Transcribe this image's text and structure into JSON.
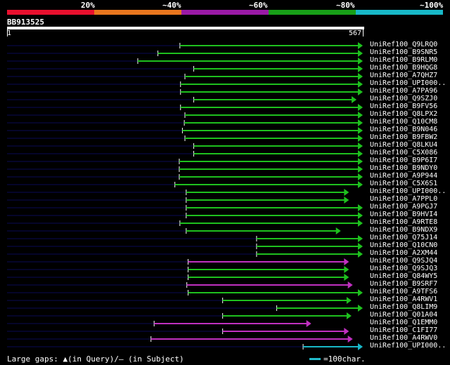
{
  "legend": {
    "segments": [
      {
        "color": "#e8102e",
        "label": "20%"
      },
      {
        "color": "#e8761e",
        "label": "~40%"
      },
      {
        "color": "#9a1aa6",
        "label": "~60%"
      },
      {
        "color": "#18a018",
        "label": "~80%"
      },
      {
        "color": "#18b8c8",
        "label": "~100%"
      }
    ]
  },
  "query": {
    "name": "BB913525",
    "start": "1",
    "end": "567",
    "length": 567
  },
  "colors": {
    "green": "#1ec01e",
    "magenta": "#c030c0",
    "cyan": "#18b8c8",
    "gap": "#0a0a55"
  },
  "hits": [
    {
      "label": "UniRef100_Q9LRQ0",
      "start": 276,
      "end": 567,
      "color": "green"
    },
    {
      "label": "UniRef100_B9SNR5",
      "start": 241,
      "end": 567,
      "color": "green"
    },
    {
      "label": "UniRef100_B9RLM0",
      "start": 209,
      "end": 567,
      "color": "green"
    },
    {
      "label": "UniRef100_B9HQG8",
      "start": 298,
      "end": 567,
      "color": "green"
    },
    {
      "label": "UniRef100_A7QHZ7",
      "start": 284,
      "end": 567,
      "color": "green"
    },
    {
      "label": "UniRef100_UPI000..",
      "start": 277,
      "end": 567,
      "color": "green"
    },
    {
      "label": "UniRef100_A7PA96",
      "start": 277,
      "end": 567,
      "color": "green"
    },
    {
      "label": "UniRef100_Q9SZJ0",
      "start": 298,
      "end": 557,
      "color": "green"
    },
    {
      "label": "UniRef100_B9FV56",
      "start": 277,
      "end": 567,
      "color": "green"
    },
    {
      "label": "UniRef100_Q8LPX2",
      "start": 284,
      "end": 567,
      "color": "green"
    },
    {
      "label": "UniRef100_Q10CM8",
      "start": 283,
      "end": 567,
      "color": "green"
    },
    {
      "label": "UniRef100_B9N046",
      "start": 280,
      "end": 567,
      "color": "green"
    },
    {
      "label": "UniRef100_B9FBW2",
      "start": 284,
      "end": 567,
      "color": "green"
    },
    {
      "label": "UniRef100_Q8LKU4",
      "start": 298,
      "end": 567,
      "color": "green"
    },
    {
      "label": "UniRef100_C5X086",
      "start": 298,
      "end": 567,
      "color": "green"
    },
    {
      "label": "UniRef100_B9P6I7",
      "start": 275,
      "end": 567,
      "color": "green"
    },
    {
      "label": "UniRef100_B9NDY0",
      "start": 275,
      "end": 567,
      "color": "green"
    },
    {
      "label": "UniRef100_A9P944",
      "start": 275,
      "end": 567,
      "color": "green"
    },
    {
      "label": "UniRef100_C5X6S1",
      "start": 268,
      "end": 567,
      "color": "green"
    },
    {
      "label": "UniRef100_UPI000..",
      "start": 286,
      "end": 545,
      "color": "green"
    },
    {
      "label": "UniRef100_A7PPL0",
      "start": 286,
      "end": 545,
      "color": "green"
    },
    {
      "label": "UniRef100_A9PGJ7",
      "start": 286,
      "end": 567,
      "color": "green"
    },
    {
      "label": "UniRef100_B9HVI4",
      "start": 286,
      "end": 567,
      "color": "green"
    },
    {
      "label": "UniRef100_A9RTE8",
      "start": 276,
      "end": 567,
      "color": "green"
    },
    {
      "label": "UniRef100_B9NDX9",
      "start": 286,
      "end": 532,
      "color": "green"
    },
    {
      "label": "UniRef100_Q75J14",
      "start": 398,
      "end": 567,
      "color": "green"
    },
    {
      "label": "UniRef100_Q10CN0",
      "start": 398,
      "end": 567,
      "color": "green"
    },
    {
      "label": "UniRef100_A2XM44",
      "start": 398,
      "end": 567,
      "color": "green"
    },
    {
      "label": "UniRef100_Q9SJQ4",
      "start": 289,
      "end": 545,
      "color": "magenta"
    },
    {
      "label": "UniRef100_Q9SJQ3",
      "start": 289,
      "end": 545,
      "color": "green"
    },
    {
      "label": "UniRef100_Q84WY5",
      "start": 289,
      "end": 545,
      "color": "green"
    },
    {
      "label": "UniRef100_B9SRF7",
      "start": 287,
      "end": 551,
      "color": "magenta"
    },
    {
      "label": "UniRef100_A9TFS6",
      "start": 289,
      "end": 567,
      "color": "green"
    },
    {
      "label": "UniRef100_A4RWV1",
      "start": 344,
      "end": 549,
      "color": "green"
    },
    {
      "label": "UniRef100_Q8LIM9",
      "start": 430,
      "end": 567,
      "color": "green"
    },
    {
      "label": "UniRef100_Q01A04",
      "start": 344,
      "end": 549,
      "color": "green"
    },
    {
      "label": "UniRef100_Q1EMM0",
      "start": 235,
      "end": 485,
      "color": "magenta"
    },
    {
      "label": "UniRef100_C1FI77",
      "start": 344,
      "end": 545,
      "color": "magenta"
    },
    {
      "label": "UniRef100_A4RWV0",
      "start": 230,
      "end": 551,
      "color": "magenta"
    },
    {
      "label": "UniRef100_UPI000..",
      "start": 472,
      "end": 567,
      "color": "cyan"
    }
  ],
  "footer": {
    "large_gaps": "Large gaps: ▲(in Query)/— (in Subject)",
    "scale": "=100char."
  }
}
